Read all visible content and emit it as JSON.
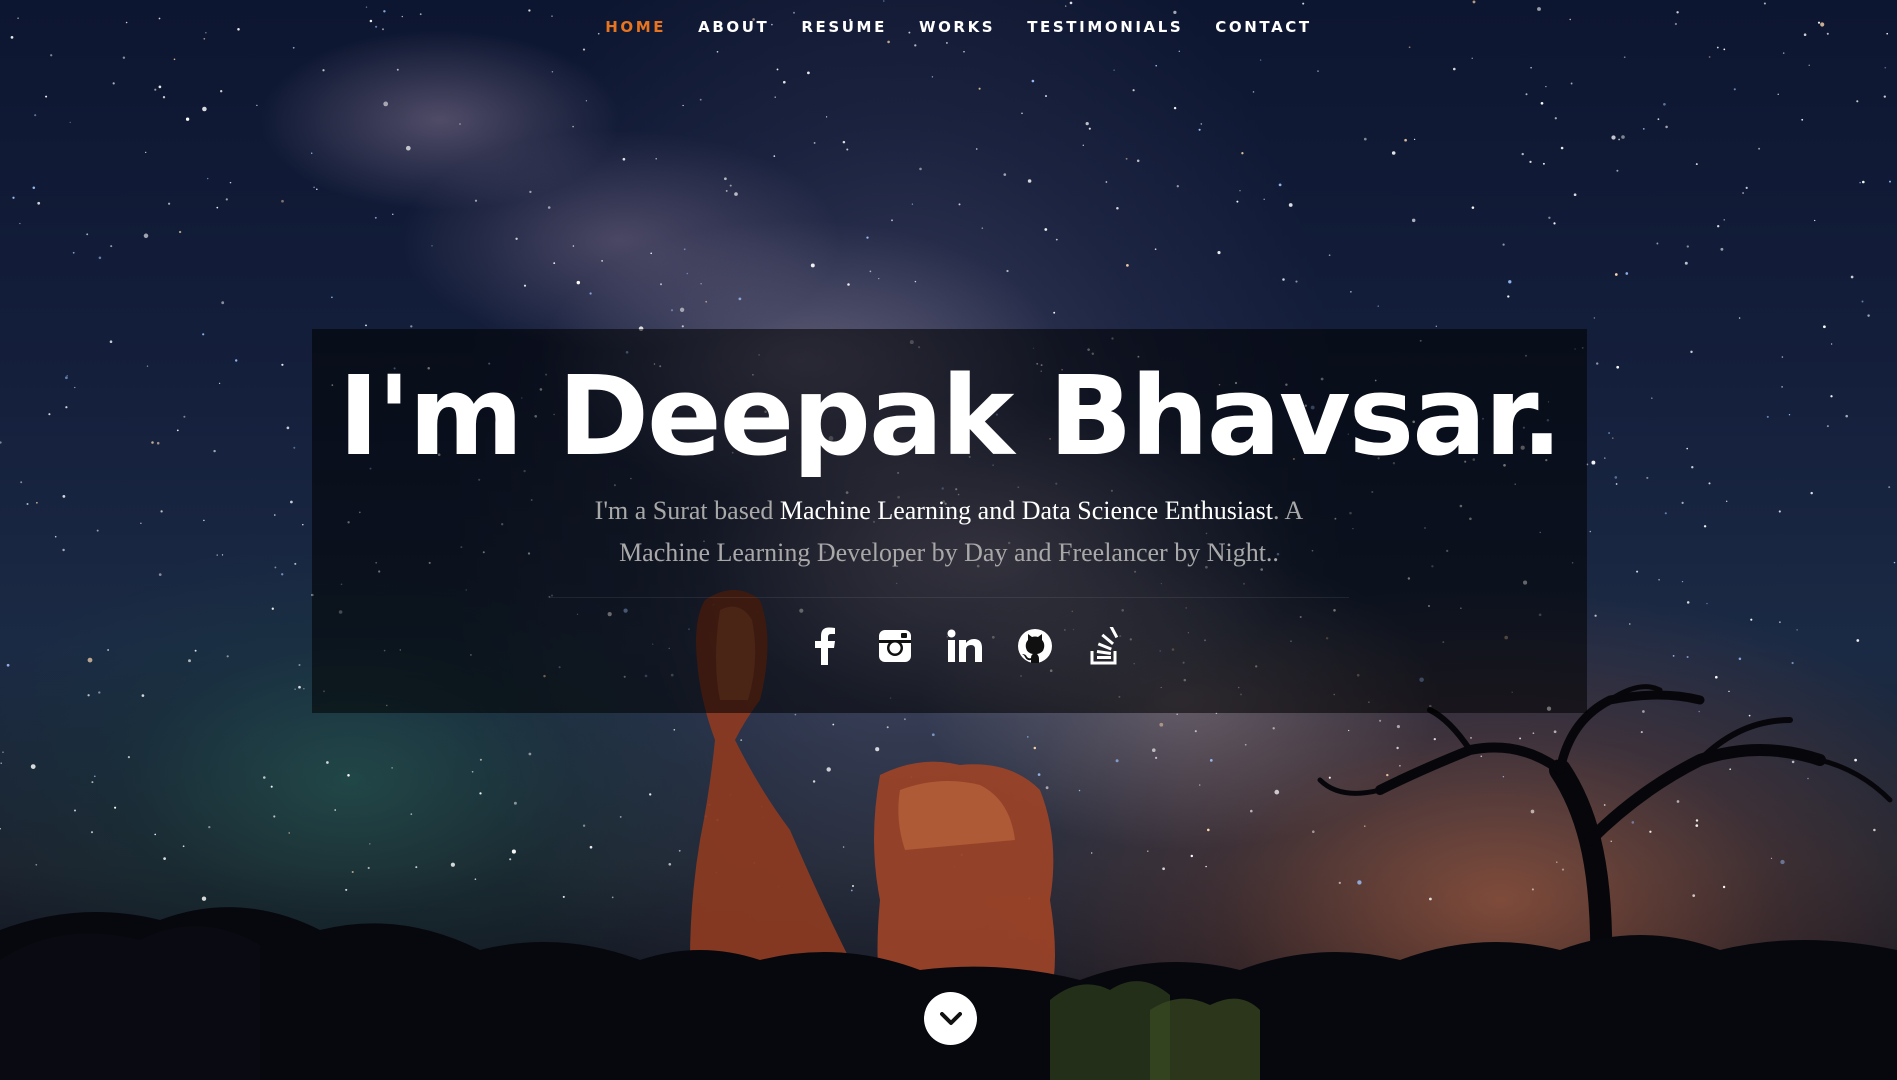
{
  "nav": {
    "items": [
      {
        "label": "HOME",
        "active": true
      },
      {
        "label": "ABOUT",
        "active": false
      },
      {
        "label": "RESUME",
        "active": false
      },
      {
        "label": "WORKS",
        "active": false
      },
      {
        "label": "TESTIMONIALS",
        "active": false
      },
      {
        "label": "CONTACT",
        "active": false
      }
    ],
    "active_color": "#e8741f"
  },
  "banner": {
    "title": "I'm Deepak Bhavsar.",
    "subtitle_pre": "I'm a Surat based ",
    "subtitle_highlight": "Machine Learning and Data Science Enthusiast",
    "subtitle_post": ". A Machine Learning Developer by Day and Freelancer by Night.."
  },
  "social": [
    {
      "icon": "facebook-icon"
    },
    {
      "icon": "instagram-icon"
    },
    {
      "icon": "linkedin-icon"
    },
    {
      "icon": "github-icon"
    },
    {
      "icon": "stackoverflow-icon"
    }
  ],
  "scroll_down": {
    "icon": "chevron-down-icon"
  }
}
